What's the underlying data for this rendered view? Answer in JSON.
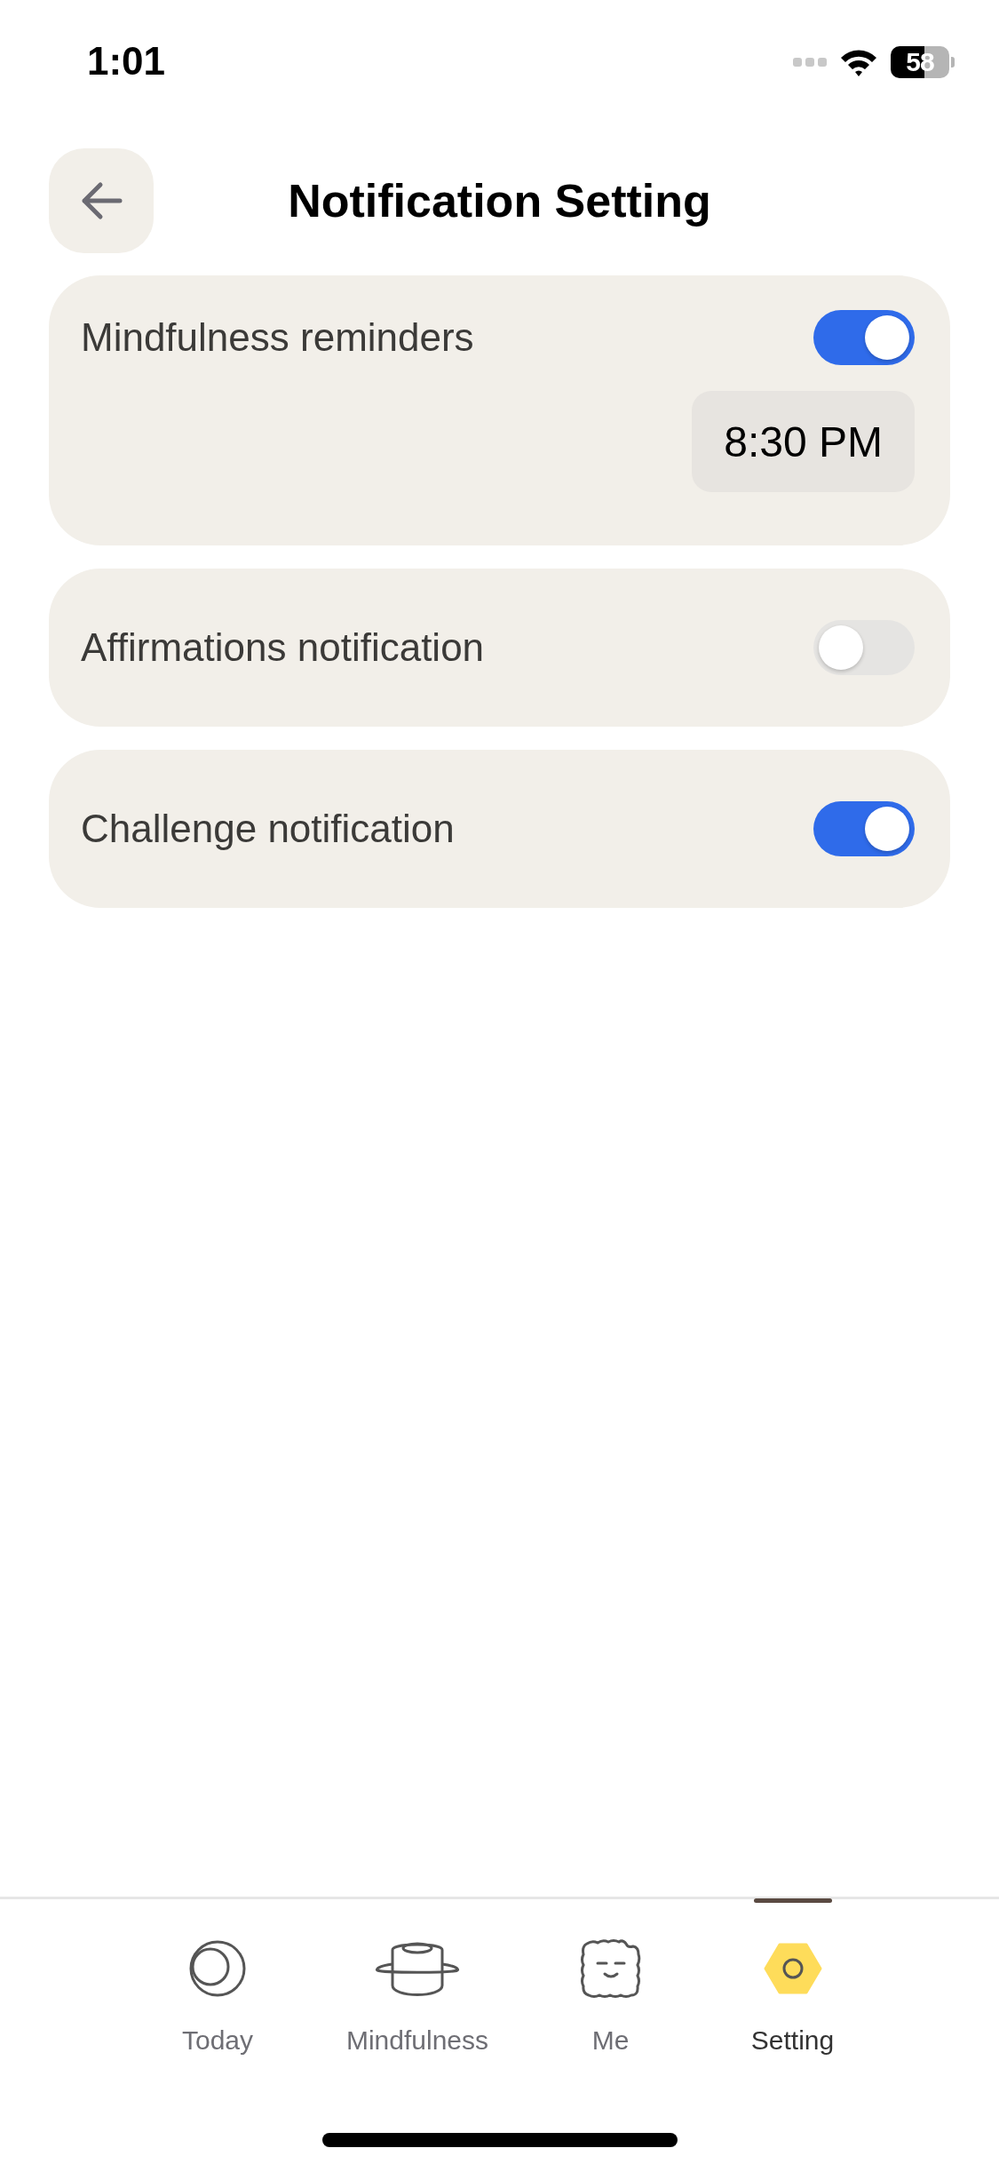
{
  "status_bar": {
    "time": "1:01",
    "battery": "58"
  },
  "header": {
    "title": "Notification Setting"
  },
  "cards": [
    {
      "label": "Mindfulness reminders",
      "on": true,
      "time": "8:30 PM"
    },
    {
      "label": "Affirmations notification",
      "on": false
    },
    {
      "label": "Challenge notification",
      "on": true
    }
  ],
  "tabs": [
    {
      "label": "Today",
      "selected": false
    },
    {
      "label": "Mindfulness",
      "selected": false
    },
    {
      "label": "Me",
      "selected": false
    },
    {
      "label": "Setting",
      "selected": true
    }
  ]
}
